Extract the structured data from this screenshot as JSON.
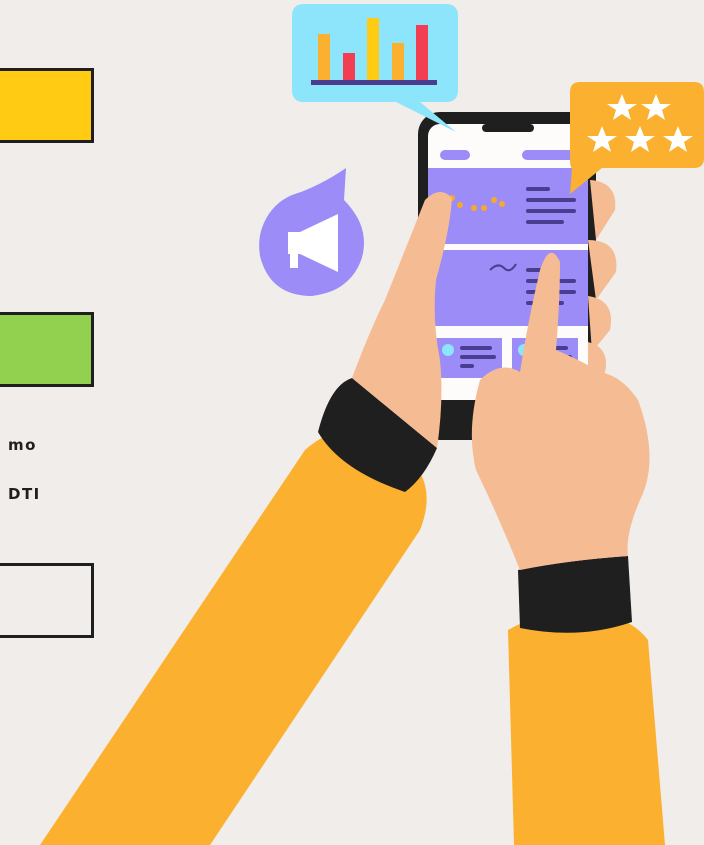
{
  "colors": {
    "background": "#f1edea",
    "box_yellow": "#ffcb13",
    "box_green": "#92d050",
    "sleeve": "#fbb02f",
    "skin": "#f5bb93",
    "phone": "#1f1f1f",
    "screen_accent": "#9b8cf8",
    "chart_bubble": "#8ce5fa",
    "rating_bubble": "#fbb02f"
  },
  "text_fragments": {
    "line_1": "mo",
    "line_2": "DTI"
  },
  "icons": {
    "chart_bubble": "bar-chart-icon",
    "rating_bubble": "star-rating-icon",
    "megaphone": "megaphone-icon"
  }
}
